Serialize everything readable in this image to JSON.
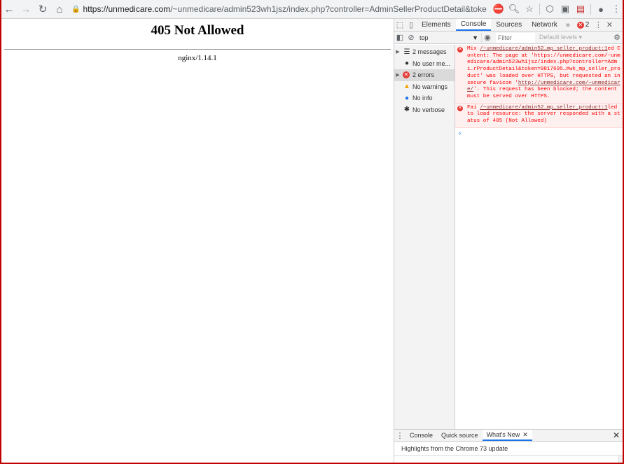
{
  "browser": {
    "url_host": "https://unmedicare.com",
    "url_rest": "/~unmedicare/admin523wh1jsz/index.php?controller=AdminSellerProductDetail&token=9817695bc958da..."
  },
  "page": {
    "heading": "405 Not Allowed",
    "server": "nginx/1.14.1"
  },
  "devtools": {
    "tabs": [
      "Elements",
      "Console",
      "Sources",
      "Network"
    ],
    "active_tab": "Console",
    "error_count": "2",
    "context": "top",
    "filter_placeholder": "Filter",
    "levels": "Default levels ▾",
    "sidebar": [
      {
        "label": "2 messages",
        "icon": "list-icon"
      },
      {
        "label": "No user me...",
        "icon": "user-icon"
      },
      {
        "label": "2 errors",
        "icon": "error-icon"
      },
      {
        "label": "No warnings",
        "icon": "warning-icon"
      },
      {
        "label": "No info",
        "icon": "info-icon"
      },
      {
        "label": "No verbose",
        "icon": "bug-icon"
      }
    ],
    "messages": [
      {
        "prefix": "Mix ",
        "link": "/~unmedicare/admin52…mp_seller_product:1",
        "text": "ed Content: The page at 'https://unmedicare.com/~unmedicare/admin523wh1jsz/index.php?controller=Admi…rProductDetail&token=9817695…#wk_mp_seller_product' was loaded over HTTPS, but requested an insecure favicon '",
        "link2": "http://unmedicare.com/~unmedicare/",
        "text2": "'. This request has been blocked; the content must be served over HTTPS."
      },
      {
        "prefix": "Fai ",
        "link": "/~unmedicare/admin52…mp_seller_product:1",
        "text": "led to load resource: the server responded with a status of 405 (Not Allowed)"
      }
    ],
    "drawer_tabs": [
      "Console",
      "Quick source",
      "What's New"
    ],
    "whats_new": "Highlights from the Chrome 73 update"
  }
}
